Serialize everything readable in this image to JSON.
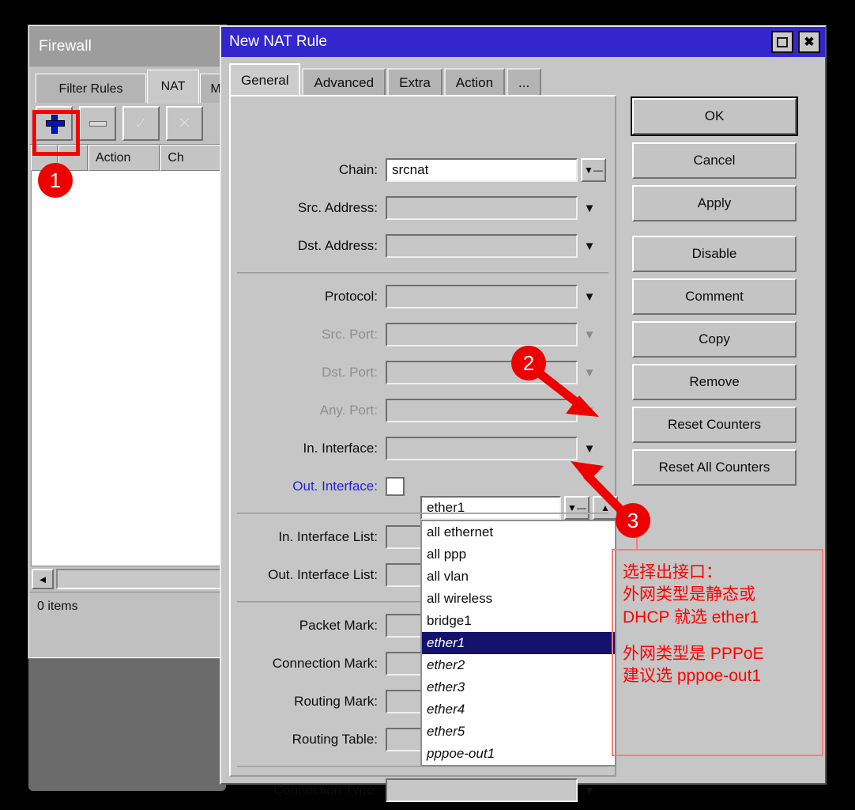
{
  "firewall": {
    "title": "Firewall",
    "tabs": [
      {
        "label": "Filter Rules",
        "active": false
      },
      {
        "label": "NAT",
        "active": true
      },
      {
        "label": "M",
        "active": false
      }
    ],
    "toolbar": [
      {
        "name": "add-button",
        "icon": "plus-icon"
      },
      {
        "name": "remove-button",
        "icon": "minus-icon"
      },
      {
        "name": "enable-button",
        "icon": "check-icon"
      },
      {
        "name": "disable-button",
        "icon": "cross-icon"
      }
    ],
    "columns": [
      "",
      "",
      "Action",
      "Ch"
    ],
    "status": "0 items"
  },
  "dialog": {
    "title": "New NAT Rule",
    "tabs": [
      {
        "label": "General",
        "active": true
      },
      {
        "label": "Advanced",
        "active": false
      },
      {
        "label": "Extra",
        "active": false
      },
      {
        "label": "Action",
        "active": false
      },
      {
        "label": "...",
        "active": false
      }
    ],
    "title_buttons": [
      {
        "name": "maximize-button",
        "icon": "square-icon"
      },
      {
        "name": "close-button",
        "icon": "close-icon",
        "glyph": "✖"
      }
    ],
    "fields": [
      {
        "label": "Chain:",
        "value": "srcnat",
        "state": "enabled",
        "white": true,
        "control": "dropbtn"
      },
      {
        "label": "Src. Address:",
        "value": "",
        "state": "enabled",
        "white": false,
        "control": "caret"
      },
      {
        "label": "Dst. Address:",
        "value": "",
        "state": "enabled",
        "white": false,
        "control": "caret"
      },
      {
        "label": "Protocol:",
        "value": "",
        "state": "enabled",
        "white": false,
        "control": "caret"
      },
      {
        "label": "Src. Port:",
        "value": "",
        "state": "disabled",
        "white": false,
        "control": "caret-dim"
      },
      {
        "label": "Dst. Port:",
        "value": "",
        "state": "disabled",
        "white": false,
        "control": "caret-dim"
      },
      {
        "label": "Any. Port:",
        "value": "",
        "state": "disabled",
        "white": false,
        "control": "caret-dim"
      },
      {
        "label": "In. Interface:",
        "value": "",
        "state": "enabled",
        "white": false,
        "control": "caret"
      },
      {
        "label": "In. Interface List:",
        "value": "",
        "state": "enabled",
        "white": false,
        "control": "caret"
      },
      {
        "label": "Out. Interface List:",
        "value": "",
        "state": "enabled",
        "white": false,
        "control": "caret"
      },
      {
        "label": "Packet Mark:",
        "value": "",
        "state": "enabled",
        "white": false,
        "control": "caret"
      },
      {
        "label": "Connection Mark:",
        "value": "",
        "state": "enabled",
        "white": false,
        "control": "caret"
      },
      {
        "label": "Routing Mark:",
        "value": "",
        "state": "enabled",
        "white": false,
        "control": "caret"
      },
      {
        "label": "Routing Table:",
        "value": "",
        "state": "enabled",
        "white": false,
        "control": "caret"
      },
      {
        "label": "Connection Type:",
        "value": "",
        "state": "enabled",
        "white": false,
        "control": "caret"
      }
    ],
    "out_interface": {
      "label": "Out. Interface:",
      "value": "ether1",
      "checkbox_checked": false,
      "options": [
        {
          "label": "all ethernet",
          "italic": false,
          "selected": false
        },
        {
          "label": "all ppp",
          "italic": false,
          "selected": false
        },
        {
          "label": "all vlan",
          "italic": false,
          "selected": false
        },
        {
          "label": "all wireless",
          "italic": false,
          "selected": false
        },
        {
          "label": "bridge1",
          "italic": false,
          "selected": false
        },
        {
          "label": "ether1",
          "italic": true,
          "selected": true
        },
        {
          "label": "ether2",
          "italic": true,
          "selected": false
        },
        {
          "label": "ether3",
          "italic": true,
          "selected": false
        },
        {
          "label": "ether4",
          "italic": true,
          "selected": false
        },
        {
          "label": "ether5",
          "italic": true,
          "selected": false
        },
        {
          "label": "pppoe-out1",
          "italic": true,
          "selected": false
        }
      ]
    },
    "buttons": [
      {
        "label": "OK",
        "default": true
      },
      {
        "label": "Cancel",
        "default": false
      },
      {
        "label": "Apply",
        "default": false
      },
      {
        "label": "Disable",
        "default": false
      },
      {
        "label": "Comment",
        "default": false
      },
      {
        "label": "Copy",
        "default": false
      },
      {
        "label": "Remove",
        "default": false
      },
      {
        "label": "Reset Counters",
        "default": false
      },
      {
        "label": "Reset All Counters",
        "default": false
      }
    ]
  },
  "annotations": {
    "markers": [
      {
        "number": "1"
      },
      {
        "number": "2"
      },
      {
        "number": "3"
      }
    ],
    "note_lines": [
      "选择出接口：",
      "外网类型是静态或",
      "DHCP 就选 ether1",
      "",
      "外网类型是 PPPoE",
      "建议选 pppoe-out1"
    ],
    "colors": {
      "marker_red": "#ee0000",
      "note_red": "#ff0000",
      "note_border": "#ff7b7b",
      "highlight_red": "#f60000"
    }
  }
}
